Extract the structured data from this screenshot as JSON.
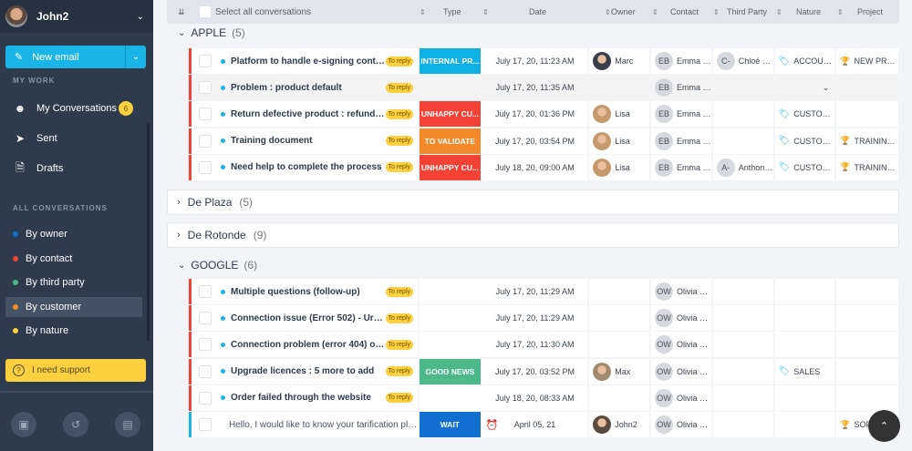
{
  "sidebar": {
    "user": "John2",
    "new_email": "New email",
    "my_work": "MY WORK",
    "my_conversations": "My Conversations",
    "my_conversations_count": "6",
    "sent": "Sent",
    "drafts": "Drafts",
    "all_conversations": "ALL CONVERSATIONS",
    "filters": [
      {
        "label": "By owner",
        "color": "#1170cf"
      },
      {
        "label": "By contact",
        "color": "#f04438"
      },
      {
        "label": "By third party",
        "color": "#4cb88c"
      },
      {
        "label": "By customer",
        "color": "#f28a2a",
        "active": true
      },
      {
        "label": "By nature",
        "color": "#fdd03f"
      }
    ],
    "support": "I need support",
    "bottom_icons": [
      "contacts-book-icon",
      "history-icon",
      "stats-icon"
    ]
  },
  "header": {
    "select_all": "Select all conversations",
    "type": "Type",
    "date": "Date",
    "owner": "Owner",
    "contact": "Contact",
    "third_party": "Third Party",
    "nature": "Nature",
    "project": "Project"
  },
  "colors": {
    "internal": "#0fb0e3",
    "unhappy": "#f44336",
    "validate": "#f28a2a",
    "good": "#4cb88c",
    "wait": "#1170cf"
  },
  "groups": [
    {
      "name": "APPLE",
      "count": "(5)",
      "expanded": true,
      "rows": [
        {
          "title": "Platform to handle e-signing contracts",
          "badge": "To reply",
          "type": "INTERNAL PR...",
          "type_color": "#0fb0e3",
          "date": "July 17, 20, 11:23 AM",
          "owner": "Marc",
          "owner_photo": "#3a3f4a",
          "contact_ini": "EB",
          "contact": "Emma Br...",
          "third_ini": "C-",
          "third": "Chloé Lo...",
          "nature": "ACCOUNTI...",
          "project": "NEW PROC..."
        },
        {
          "title": "Problem : product default",
          "badge": "To reply",
          "type": "",
          "date": "July 17, 20, 11:35 AM",
          "owner": "",
          "contact_ini": "EB",
          "contact": "Emma Br...",
          "third": "",
          "nature": "",
          "project": "",
          "hover": true
        },
        {
          "title": "Return defective product : refund !!!",
          "badge": "To reply",
          "type": "UNHAPPY CU...",
          "type_color": "#f44336",
          "date": "July 17, 20, 01:36 PM",
          "owner": "Lisa",
          "owner_photo": "#c49a6c",
          "contact_ini": "EB",
          "contact": "Emma Br...",
          "third": "",
          "nature": "CUSTOME...",
          "project": ""
        },
        {
          "title": "Training document",
          "badge": "To reply",
          "type": "TO VALIDATE",
          "type_color": "#f28a2a",
          "date": "July 17, 20, 03:54 PM",
          "owner": "Lisa",
          "owner_photo": "#c49a6c",
          "contact_ini": "EB",
          "contact": "Emma Br...",
          "third": "",
          "nature": "CUSTOME...",
          "project": "TRAINING ..."
        },
        {
          "title": "Need help to complete the process",
          "badge": "To reply",
          "type": "UNHAPPY CU...",
          "type_color": "#f44336",
          "date": "July 18, 20, 09:00 AM",
          "owner": "Lisa",
          "owner_photo": "#c49a6c",
          "contact_ini": "EB",
          "contact": "Emma Br...",
          "third_ini": "A-",
          "third": "Anthony ...",
          "nature": "CUSTOME...",
          "project": "TRAINING ..."
        }
      ]
    },
    {
      "name": "De Plaza",
      "count": "(5)",
      "expanded": false,
      "rows": []
    },
    {
      "name": "De Rotonde",
      "count": "(9)",
      "expanded": false,
      "rows": []
    },
    {
      "name": "GOOGLE",
      "count": "(6)",
      "expanded": true,
      "rows": [
        {
          "title": "Multiple questions (follow-up)",
          "badge": "To reply",
          "type": "",
          "date": "July 17, 20, 11:29 AM",
          "owner": "",
          "contact_ini": "OW",
          "contact": "Olivia Wil...",
          "third": "",
          "nature": "",
          "project": ""
        },
        {
          "title": "Connection issue (Error 502) - Urgent!!",
          "badge": "To reply",
          "type": "",
          "date": "July 17, 20, 11:29 AM",
          "owner": "",
          "contact_ini": "OW",
          "contact": "Olivia Wil...",
          "third": "",
          "nature": "",
          "project": ""
        },
        {
          "title": "Connection problem (error 404) on Ipa...",
          "badge": "To reply",
          "type": "",
          "date": "July 17, 20, 11:30 AM",
          "owner": "",
          "contact_ini": "OW",
          "contact": "Olivia Wil...",
          "third": "",
          "nature": "",
          "project": ""
        },
        {
          "title": "Upgrade licences : 5 more to add",
          "badge": "To reply",
          "type": "GOOD NEWS",
          "type_color": "#4cb88c",
          "date": "July 17, 20, 03:52 PM",
          "owner": "Max",
          "owner_photo": "#a08a70",
          "contact_ini": "OW",
          "contact": "Olivia Wil...",
          "third": "",
          "nature": "SALES",
          "project": ""
        },
        {
          "title": "Order failed through the website",
          "badge": "To reply",
          "type": "",
          "date": "July 18, 20, 08:33 AM",
          "owner": "",
          "contact_ini": "OW",
          "contact": "Olivia Wil...",
          "third": "",
          "nature": "",
          "project": ""
        },
        {
          "title": "Hello, I would like to know your tarification plan",
          "badge": "",
          "type": "WAIT",
          "type_color": "#1170cf",
          "date": "April 05, 21",
          "alarm": true,
          "read": true,
          "owner": "John2",
          "owner_photo": "#5a4a40",
          "contact_ini": "OW",
          "contact": "Olivia Wil...",
          "third": "",
          "nature": "",
          "project": "SOFTWARE"
        }
      ]
    }
  ]
}
